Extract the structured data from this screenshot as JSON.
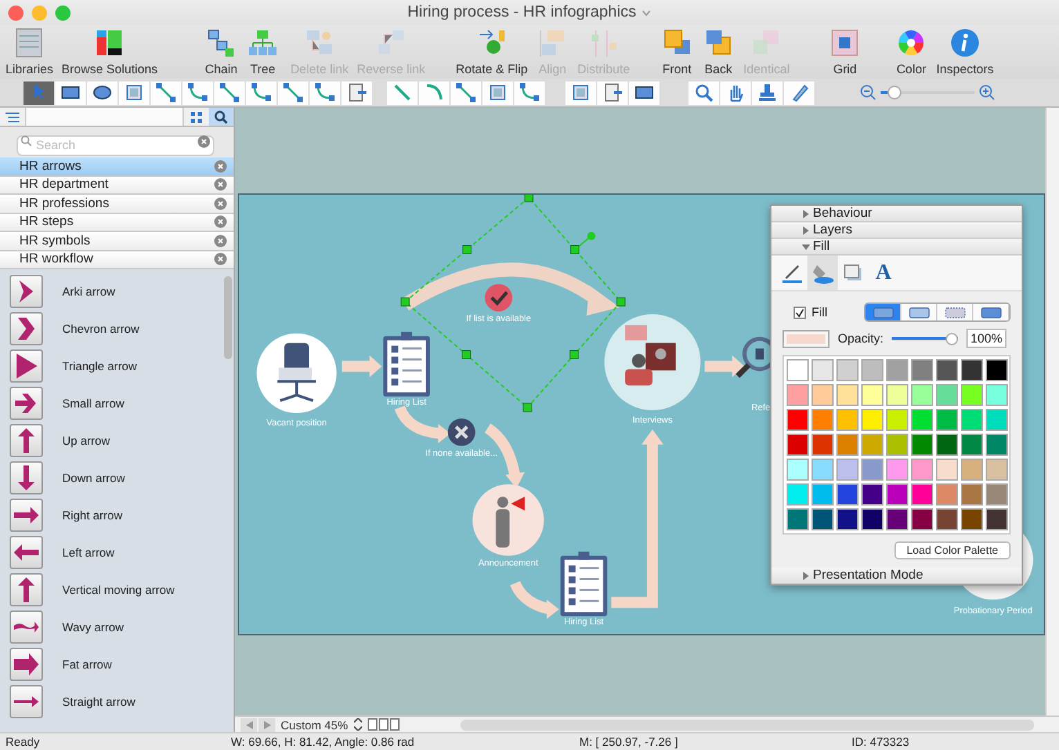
{
  "window": {
    "title": "Hiring process - HR infographics"
  },
  "toolbar": [
    {
      "label": "Libraries",
      "kind": "libraries",
      "disabled": false
    },
    {
      "label": "Browse Solutions",
      "kind": "solutions",
      "disabled": false
    },
    {
      "label": "Chain",
      "kind": "chain",
      "disabled": false
    },
    {
      "label": "Tree",
      "kind": "tree",
      "disabled": false
    },
    {
      "label": "Delete link",
      "kind": "delete-link",
      "disabled": true
    },
    {
      "label": "Reverse link",
      "kind": "reverse-link",
      "disabled": true
    },
    {
      "label": "Rotate & Flip",
      "kind": "rotate",
      "disabled": false
    },
    {
      "label": "Align",
      "kind": "align",
      "disabled": true
    },
    {
      "label": "Distribute",
      "kind": "distribute",
      "disabled": true
    },
    {
      "label": "Front",
      "kind": "front",
      "disabled": false
    },
    {
      "label": "Back",
      "kind": "back",
      "disabled": false
    },
    {
      "label": "Identical",
      "kind": "identical",
      "disabled": true
    },
    {
      "label": "Grid",
      "kind": "grid",
      "disabled": false
    },
    {
      "label": "Color",
      "kind": "color",
      "disabled": false
    },
    {
      "label": "Inspectors",
      "kind": "inspectors",
      "disabled": false
    }
  ],
  "tool_groups": [
    {
      "tools": [
        {
          "kind": "pointer",
          "selected": true
        },
        {
          "kind": "rect",
          "selected": false
        },
        {
          "kind": "ellipse",
          "selected": false
        },
        {
          "kind": "frame",
          "selected": false
        },
        {
          "kind": "connector",
          "selected": false
        },
        {
          "kind": "curve",
          "selected": false
        },
        {
          "kind": "connector",
          "selected": false
        },
        {
          "kind": "curve",
          "selected": false
        },
        {
          "kind": "connector",
          "selected": false
        },
        {
          "kind": "curve",
          "selected": false
        },
        {
          "kind": "insert",
          "selected": false
        }
      ]
    },
    {
      "tools": [
        {
          "kind": "line",
          "selected": false
        },
        {
          "kind": "arc",
          "selected": false
        },
        {
          "kind": "connector",
          "selected": false
        },
        {
          "kind": "frame",
          "selected": false
        },
        {
          "kind": "curve",
          "selected": false
        }
      ]
    },
    {
      "tools": [
        {
          "kind": "frame",
          "selected": false
        },
        {
          "kind": "insert",
          "selected": false
        },
        {
          "kind": "rect",
          "selected": false
        }
      ]
    },
    {
      "tools": [
        {
          "kind": "search",
          "selected": false
        },
        {
          "kind": "hand",
          "selected": false
        },
        {
          "kind": "stamp",
          "selected": false
        },
        {
          "kind": "pen",
          "selected": false
        }
      ]
    }
  ],
  "zoom": {
    "level": 0.08
  },
  "search": {
    "placeholder": "Search"
  },
  "libraries": [
    {
      "label": "HR arrows",
      "selected": true
    },
    {
      "label": "HR department",
      "selected": false
    },
    {
      "label": "HR professions",
      "selected": false
    },
    {
      "label": "HR steps",
      "selected": false
    },
    {
      "label": "HR symbols",
      "selected": false
    },
    {
      "label": "HR workflow",
      "selected": false
    }
  ],
  "shapes": [
    {
      "label": "Arki arrow",
      "kind": "arki"
    },
    {
      "label": "Chevron arrow",
      "kind": "chevron"
    },
    {
      "label": "Triangle arrow",
      "kind": "triangle"
    },
    {
      "label": "Small arrow",
      "kind": "small"
    },
    {
      "label": "Up arrow",
      "kind": "up"
    },
    {
      "label": "Down arrow",
      "kind": "down"
    },
    {
      "label": "Right arrow",
      "kind": "right"
    },
    {
      "label": "Left arrow",
      "kind": "left"
    },
    {
      "label": "Vertical moving arrow",
      "kind": "up"
    },
    {
      "label": "Wavy arrow",
      "kind": "wavy"
    },
    {
      "label": "Fat arrow",
      "kind": "fat"
    },
    {
      "label": "Straight arrow",
      "kind": "straight"
    }
  ],
  "diagram": {
    "nodes": [
      {
        "label": "Vacant position",
        "kind": "chair"
      },
      {
        "label": "Hiring List",
        "kind": "clipboard"
      },
      {
        "label": "If list is available",
        "kind": "check"
      },
      {
        "label": "If none available...",
        "kind": "cross"
      },
      {
        "label": "Announcement",
        "kind": "announcement"
      },
      {
        "label": "Hiring List",
        "kind": "clipboard"
      },
      {
        "label": "Interviews",
        "kind": "interview"
      },
      {
        "label": "Refe",
        "kind": "magnifier"
      },
      {
        "label": "Probationary Period",
        "kind": "badge"
      }
    ],
    "connectors": [
      {
        "selected": true
      },
      {
        "selected": false
      },
      {
        "selected": false
      },
      {
        "selected": false
      },
      {
        "selected": false
      },
      {
        "selected": false
      },
      {
        "selected": false
      }
    ]
  },
  "inspector": {
    "sections": [
      {
        "label": "Behaviour",
        "expanded": false
      },
      {
        "label": "Layers",
        "expanded": false
      },
      {
        "label": "Fill",
        "expanded": true
      },
      {
        "label": "Presentation Mode",
        "expanded": false
      }
    ],
    "tabs": [
      {
        "kind": "line",
        "selected": false
      },
      {
        "kind": "fill",
        "selected": true
      },
      {
        "kind": "shadow",
        "selected": false
      },
      {
        "kind": "text",
        "label": "A",
        "selected": false
      }
    ],
    "fill_checkbox": {
      "label": "Fill",
      "checked": true
    },
    "fill_styles": [
      {
        "kind": "solid",
        "selected": true
      },
      {
        "kind": "gradient",
        "selected": false
      },
      {
        "kind": "pattern",
        "selected": false
      },
      {
        "kind": "image",
        "selected": false
      }
    ],
    "current": {
      "color": "#f6d8cc"
    },
    "opacity": {
      "label": "Opacity:",
      "level": 1,
      "reading": "100%"
    },
    "swatches": [
      {
        "color": "#ffffff"
      },
      {
        "color": "#e6e6e6"
      },
      {
        "color": "#d0d0d0"
      },
      {
        "color": "#bdbdbd"
      },
      {
        "color": "#a0a0a0"
      },
      {
        "color": "#808080"
      },
      {
        "color": "#555555"
      },
      {
        "color": "#333333"
      },
      {
        "color": "#000000"
      },
      {
        "color": "#ff9f9f"
      },
      {
        "color": "#ffcc99"
      },
      {
        "color": "#ffe099"
      },
      {
        "color": "#ffff99"
      },
      {
        "color": "#eeff99"
      },
      {
        "color": "#99ff99"
      },
      {
        "color": "#66dd99"
      },
      {
        "color": "#77ff22"
      },
      {
        "color": "#77ffdd"
      },
      {
        "color": "#ff0000"
      },
      {
        "color": "#ff8000"
      },
      {
        "color": "#ffc000"
      },
      {
        "color": "#ffee00"
      },
      {
        "color": "#ccee00"
      },
      {
        "color": "#00dd33"
      },
      {
        "color": "#00bb44"
      },
      {
        "color": "#00dd77"
      },
      {
        "color": "#00ddbb"
      },
      {
        "color": "#dd0000"
      },
      {
        "color": "#dd3300"
      },
      {
        "color": "#dd8000"
      },
      {
        "color": "#ccaa00"
      },
      {
        "color": "#aac000"
      },
      {
        "color": "#008800"
      },
      {
        "color": "#006611"
      },
      {
        "color": "#008844"
      },
      {
        "color": "#008866"
      },
      {
        "color": "#aaffff"
      },
      {
        "color": "#88ddff"
      },
      {
        "color": "#bbc0ee"
      },
      {
        "color": "#8899cc"
      },
      {
        "color": "#ff99ee"
      },
      {
        "color": "#ff99cc"
      },
      {
        "color": "#f8dccc"
      },
      {
        "color": "#d8b080"
      },
      {
        "color": "#d8c0a0"
      },
      {
        "color": "#00eeee"
      },
      {
        "color": "#00bbee"
      },
      {
        "color": "#2244dd"
      },
      {
        "color": "#440088"
      },
      {
        "color": "#bb00bb"
      },
      {
        "color": "#ff0099"
      },
      {
        "color": "#dd8866"
      },
      {
        "color": "#aa7744"
      },
      {
        "color": "#998877"
      },
      {
        "color": "#007777"
      },
      {
        "color": "#005577"
      },
      {
        "color": "#111188"
      },
      {
        "color": "#110066"
      },
      {
        "color": "#660077"
      },
      {
        "color": "#880044"
      },
      {
        "color": "#774433"
      },
      {
        "color": "#774400"
      },
      {
        "color": "#443333"
      }
    ],
    "load_button": "Load Color Palette"
  },
  "page_zoom": "Custom 45%",
  "status_bar": {
    "state": "Ready",
    "size": "W: 69.66,  H: 81.42,  Angle: 0.86 rad",
    "mouse": "M: [ 250.97, -7.26 ]",
    "id": "ID: 473323"
  }
}
